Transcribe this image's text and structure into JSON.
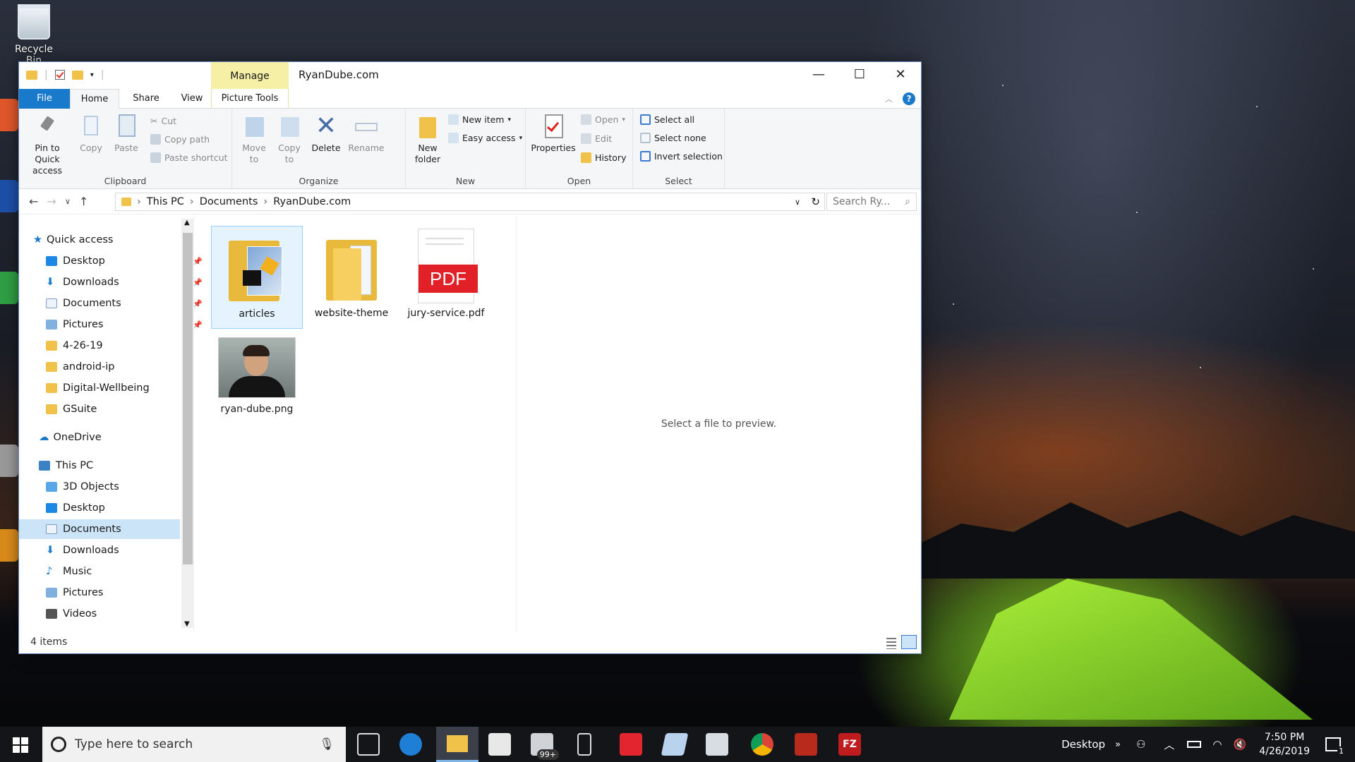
{
  "desktop": {
    "recycle_bin_label": "Recycle Bin"
  },
  "window": {
    "title": "RyanDube.com",
    "context_tab_group": "Manage",
    "controls": {
      "minimize": "—",
      "maximize": "☐",
      "close": "✕"
    }
  },
  "ribbon_tabs": {
    "file": "File",
    "home": "Home",
    "share": "Share",
    "view": "View",
    "picture_tools": "Picture Tools"
  },
  "ribbon": {
    "clipboard": {
      "label": "Clipboard",
      "pin": "Pin to Quick access",
      "copy": "Copy",
      "paste": "Paste",
      "cut": "Cut",
      "copy_path": "Copy path",
      "paste_shortcut": "Paste shortcut"
    },
    "organize": {
      "label": "Organize",
      "move_to": "Move to",
      "copy_to": "Copy to",
      "delete": "Delete",
      "rename": "Rename"
    },
    "new": {
      "label": "New",
      "new_folder": "New folder",
      "new_item": "New item",
      "easy_access": "Easy access"
    },
    "open": {
      "label": "Open",
      "properties": "Properties",
      "open": "Open",
      "edit": "Edit",
      "history": "History"
    },
    "select": {
      "label": "Select",
      "select_all": "Select all",
      "select_none": "Select none",
      "invert_selection": "Invert selection"
    }
  },
  "address": {
    "crumbs": [
      "This PC",
      "Documents",
      "RyanDube.com"
    ],
    "search_placeholder": "Search Ry..."
  },
  "nav": {
    "quick_access": "Quick access",
    "quick_items": [
      "Desktop",
      "Downloads",
      "Documents",
      "Pictures",
      "4-26-19",
      "android-ip",
      "Digital-Wellbeing",
      "GSuite"
    ],
    "onedrive": "OneDrive",
    "this_pc": "This PC",
    "pc_items": [
      "3D Objects",
      "Desktop",
      "Documents",
      "Downloads",
      "Music",
      "Pictures",
      "Videos"
    ]
  },
  "files": [
    {
      "name": "articles",
      "kind": "folder-image"
    },
    {
      "name": "website-theme",
      "kind": "folder-docs"
    },
    {
      "name": "jury-service.pdf",
      "kind": "pdf"
    },
    {
      "name": "ryan-dube.png",
      "kind": "photo"
    }
  ],
  "pdf_badge": "PDF",
  "preview_text": "Select a file to preview.",
  "status_text": "4 items",
  "taskbar": {
    "search_placeholder": "Type here to search",
    "mail_badge": "99+",
    "desktop_label": "Desktop",
    "time": "7:50 PM",
    "date": "4/26/2019",
    "notification_count": "1"
  },
  "colors": {
    "accent": "#1979ca",
    "manage_tab": "#f5f0a6",
    "selection": "#cce4f7",
    "pdf_red": "#e12127",
    "folder": "#f1c24a"
  }
}
